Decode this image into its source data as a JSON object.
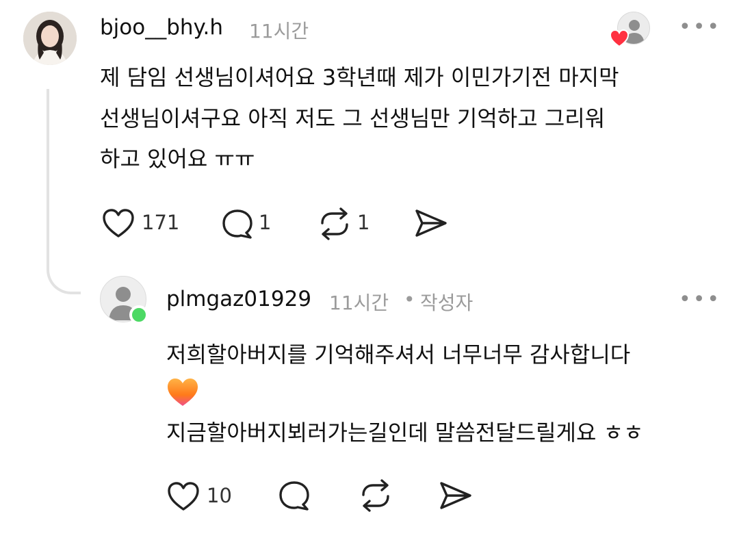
{
  "comment": {
    "username": "bjoo__bhy.h",
    "time": "11시간",
    "more_label": "•••",
    "lines": [
      "제 담임 선생님이셔어요 3학년때 제가 이민가기전 마지막",
      "선생님이셔구요 아직 저도 그 선생님만 기억하고 그리워",
      "하고 있어요 ㅠㅠ"
    ],
    "likes": "171",
    "replies": "1",
    "reposts": "1",
    "icons": [
      "heart-outline-icon",
      "comment-bubble-icon",
      "repost-icon",
      "share-send-icon"
    ]
  },
  "reply": {
    "username": "plmgaz01929",
    "time": "11시간",
    "separator": "•",
    "author_badge": "작성자",
    "more_label": "•••",
    "lines": [
      "저희할아버지를 기억해주셔서 너무너무 감사합니다",
      "지금할아버지뵈러가는길인데 말씀전달드릴게요 ㅎㅎ"
    ],
    "likes": "10",
    "emoji": "orange-heart-emoji"
  },
  "colors": {
    "like_heart": "#ff3040",
    "online": "#4cd964",
    "muted_text": "#9b9b9b",
    "thread_line": "#e2e2e2"
  }
}
